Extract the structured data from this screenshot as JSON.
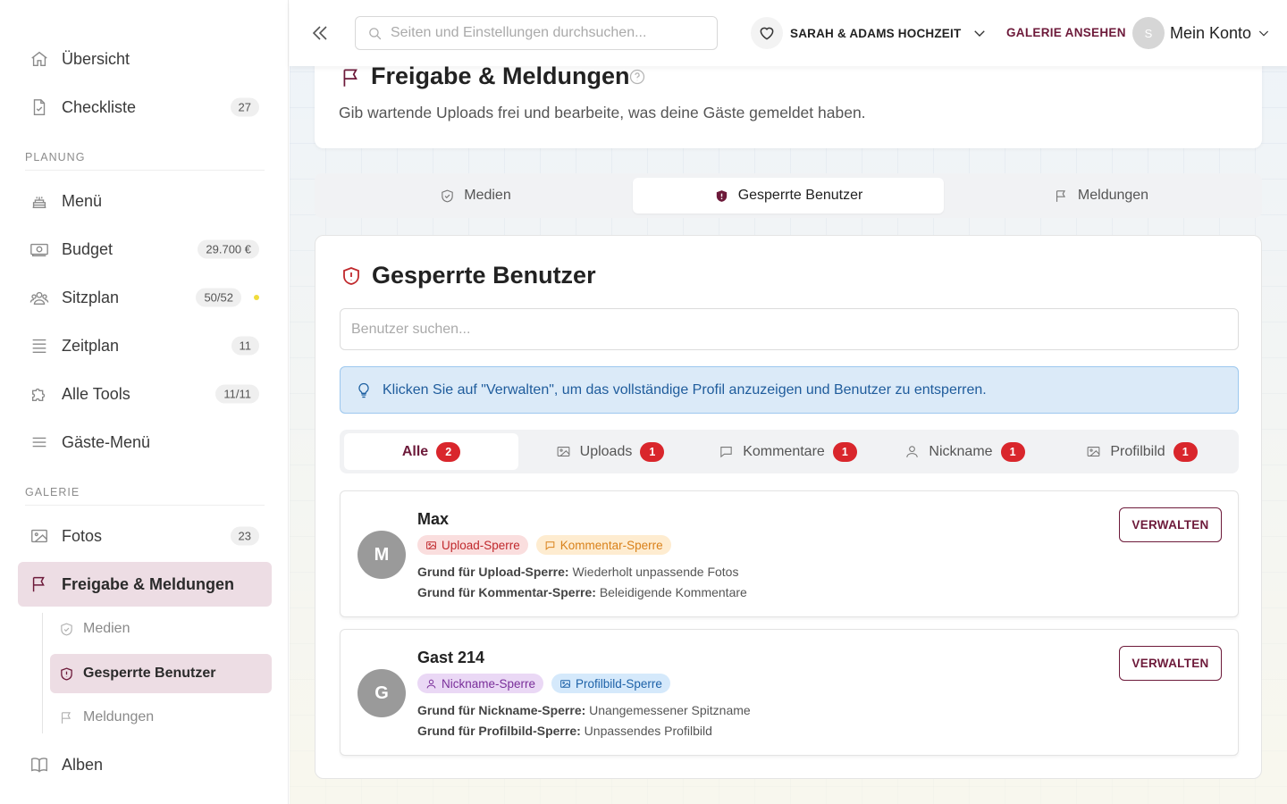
{
  "colors": {
    "brand": "#6d1a3a",
    "badge_red": "#d9262c",
    "info_bg": "#dbeaf8"
  },
  "sidebar": {
    "items": [
      {
        "label": "Übersicht",
        "icon": "home-icon"
      },
      {
        "label": "Checkliste",
        "icon": "checklist-icon",
        "count": "27"
      }
    ],
    "planung_label": "PLANUNG",
    "planung": [
      {
        "label": "Menü",
        "icon": "cake-icon"
      },
      {
        "label": "Budget",
        "icon": "money-icon",
        "count": "29.700 €"
      },
      {
        "label": "Sitzplan",
        "icon": "people-icon",
        "count": "50/52"
      },
      {
        "label": "Zeitplan",
        "icon": "lines-icon",
        "count": "11"
      },
      {
        "label": "Alle Tools",
        "icon": "puzzle-icon",
        "count": "11/11"
      },
      {
        "label": "Gäste-Menü",
        "icon": "menu-icon"
      }
    ],
    "galerie_label": "GALERIE",
    "galerie": [
      {
        "label": "Fotos",
        "icon": "image-icon",
        "count": "23"
      },
      {
        "label": "Freigabe & Meldungen",
        "icon": "flag-icon"
      }
    ],
    "sub": [
      {
        "label": "Medien",
        "icon": "shield-check-icon"
      },
      {
        "label": "Gesperrte Benutzer",
        "icon": "shield-alert-icon"
      },
      {
        "label": "Meldungen",
        "icon": "flag-icon"
      }
    ],
    "alben": {
      "label": "Alben",
      "icon": "book-icon"
    }
  },
  "topbar": {
    "search_placeholder": "Seiten und Einstellungen durchsuchen...",
    "event_name": "SARAH & ADAMS HOCHZEIT",
    "gallery_link": "GALERIE ANSEHEN",
    "account_initial": "S",
    "account_label": "Mein Konto"
  },
  "header": {
    "title": "Freigabe & Meldungen",
    "subtitle": "Gib wartende Uploads frei und bearbeite, was deine Gäste gemeldet haben."
  },
  "tabs": [
    {
      "label": "Medien",
      "icon": "shield-check-icon"
    },
    {
      "label": "Gesperrte Benutzer",
      "icon": "shield-alert-icon"
    },
    {
      "label": "Meldungen",
      "icon": "flag-icon"
    }
  ],
  "content": {
    "title": "Gesperrte Benutzer",
    "search_placeholder": "Benutzer suchen...",
    "info": "Klicken Sie auf \"Verwalten\", um das vollständige Profil anzuzeigen und Benutzer zu entsperren.",
    "filters": [
      {
        "label": "Alle",
        "count": "2"
      },
      {
        "label": "Uploads",
        "count": "1",
        "icon": "image-icon"
      },
      {
        "label": "Kommentare",
        "count": "1",
        "icon": "comment-icon"
      },
      {
        "label": "Nickname",
        "count": "1",
        "icon": "user-icon"
      },
      {
        "label": "Profilbild",
        "count": "1",
        "icon": "image-icon"
      }
    ],
    "manage_label": "VERWALTEN",
    "users": [
      {
        "initial": "M",
        "name": "Max",
        "tags": [
          "Upload-Sperre",
          "Kommentar-Sperre"
        ],
        "reasons": [
          {
            "label": "Grund für Upload-Sperre:",
            "text": "Wiederholt unpassende Fotos"
          },
          {
            "label": "Grund für Kommentar-Sperre:",
            "text": "Beleidigende Kommentare"
          }
        ]
      },
      {
        "initial": "G",
        "name": "Gast 214",
        "tags": [
          "Nickname-Sperre",
          "Profilbild-Sperre"
        ],
        "reasons": [
          {
            "label": "Grund für Nickname-Sperre:",
            "text": "Unangemessener Spitzname"
          },
          {
            "label": "Grund für Profilbild-Sperre:",
            "text": "Unpassendes Profilbild"
          }
        ]
      }
    ]
  }
}
